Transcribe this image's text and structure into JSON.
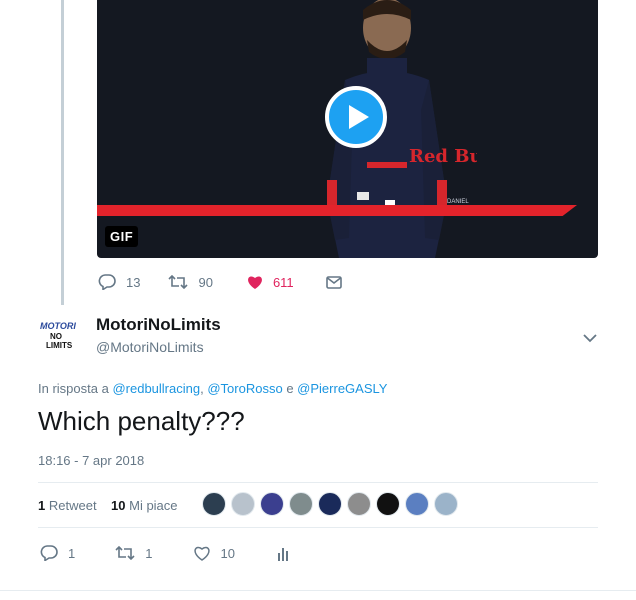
{
  "media": {
    "badge": "GIF",
    "suit_text": "Red Bull",
    "name_patch": "DANIEL"
  },
  "parent_actions": {
    "replies": "13",
    "retweets": "90",
    "likes": "611"
  },
  "tweet": {
    "display_name": "MotoriNoLimits",
    "handle": "@MotoriNoLimits",
    "avatar_text": [
      "MOTORI",
      "NO",
      "LIMITS"
    ],
    "reply_prefix": "In risposta a",
    "reply_users": [
      "@redbullracing",
      "@ToroRosso",
      "@PierreGASLY"
    ],
    "reply_sep": ",",
    "reply_and": "e",
    "text": "Which penalty???",
    "timestamp": "18:16 - 7 apr 2018",
    "stats": {
      "retweet_count": "1",
      "retweet_label": "Retweet",
      "like_count": "10",
      "like_label": "Mi piace"
    },
    "likers": [
      "#2c3e50",
      "#b8c2cc",
      "#3b3f8f",
      "#7f8c8d",
      "#1a2a5a",
      "#8d8d8d",
      "#111111",
      "#5b7fc1",
      "#9bb3c9"
    ],
    "actions": {
      "replies": "1",
      "retweets": "1",
      "likes": "10"
    }
  },
  "colors": {
    "accent": "#1da1f2",
    "like": "#e0245e",
    "muted": "#657786"
  }
}
